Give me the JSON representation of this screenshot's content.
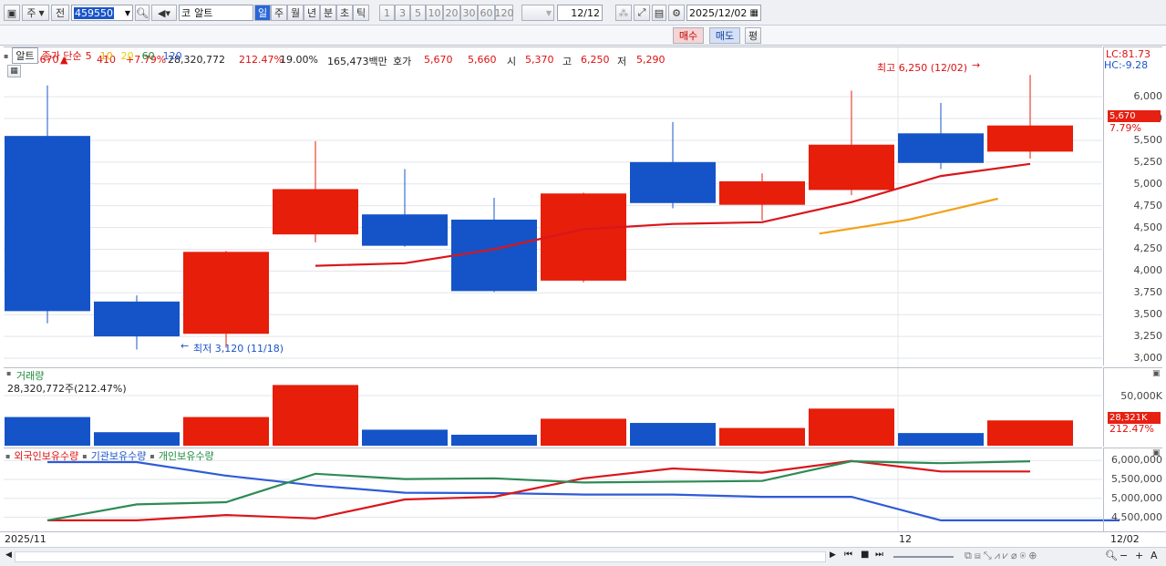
{
  "toolbar": {
    "market": "주",
    "prev_label": "전",
    "code": "459550",
    "stock_name": "알트",
    "periods": [
      "일",
      "주",
      "월",
      "년",
      "분",
      "초",
      "틱"
    ],
    "numbers": [
      "1",
      "3",
      "5",
      "10",
      "20",
      "30",
      "60",
      "120"
    ],
    "count": "12",
    "count_total": "/12",
    "date": "2025/12/02",
    "search_prefix": "코"
  },
  "quote": {
    "price": "5,670",
    "arrow": "▲",
    "change": "410",
    "change_pct": "+7.79%",
    "volume": "28,320,772",
    "volume_ratio": "212.47%",
    "turnover": "19.00%",
    "amount": "165,473백만",
    "ask_label": "호가",
    "ask": "5,670",
    "bid": "5,660",
    "open_label": "시",
    "open": "5,370",
    "high_label": "고",
    "high": "6,250",
    "low_label": "저",
    "low": "5,290",
    "buy_label": "매수",
    "sell_label": "매도",
    "eval_label": "평"
  },
  "price_panel": {
    "name": "알트",
    "ma_title": "종가 단순",
    "ma_periods": [
      {
        "label": "5",
        "color": "#d11"
      },
      {
        "label": "10",
        "color": "#f0a800"
      },
      {
        "label": "20",
        "color": "#e8d000"
      },
      {
        "label": "60",
        "color": "#1d8a3a"
      },
      {
        "label": "120",
        "color": "#2a5bd7"
      }
    ],
    "lc": "LC:81.73",
    "hc": "HC:-9.28",
    "high_note": "최고 6,250 (12/02)",
    "low_note": "최저 3,120 (11/18)",
    "cur_tag": "5,670",
    "cur_pct": "7.79%",
    "yticks": [
      "6,000",
      "5,750",
      "5,500",
      "5,250",
      "5,000",
      "4,750",
      "4,500",
      "4,250",
      "4,000",
      "3,750",
      "3,500",
      "3,250",
      "3,000"
    ]
  },
  "vol_panel": {
    "title": "거래량",
    "value": "28,320,772주(212.47%)",
    "ytick": "50,000K",
    "cur_tag": "28,321K",
    "cur_pct": "212.47%"
  },
  "hold_panel": {
    "foreign": "외국인보유수량",
    "inst": "기관보유수량",
    "indiv": "개인보유수량",
    "yticks": [
      "6,000,000",
      "5,500,000",
      "5,000,000",
      "4,500,000"
    ]
  },
  "xaxis": {
    "left": "2025/11",
    "mid": "12",
    "right": "12/02"
  },
  "chart_data": {
    "type": "candlestick",
    "ylim": [
      3000,
      6200
    ],
    "candles": [
      {
        "o": 5550,
        "h": 6130,
        "l": 3400,
        "c": 3540,
        "vol": 34
      },
      {
        "o": 3650,
        "h": 3720,
        "l": 3100,
        "c": 3250,
        "vol": 16
      },
      {
        "o": 3280,
        "h": 4230,
        "l": 3120,
        "c": 4220,
        "vol": 34
      },
      {
        "o": 4420,
        "h": 5490,
        "l": 4330,
        "c": 4940,
        "vol": 72
      },
      {
        "o": 4650,
        "h": 5170,
        "l": 4280,
        "c": 4290,
        "vol": 19
      },
      {
        "o": 4590,
        "h": 4840,
        "l": 3760,
        "c": 3770,
        "vol": 13
      },
      {
        "o": 3890,
        "h": 4900,
        "l": 3870,
        "c": 4890,
        "vol": 32
      },
      {
        "o": 5250,
        "h": 5710,
        "l": 4720,
        "c": 4780,
        "vol": 27
      },
      {
        "o": 4760,
        "h": 5120,
        "l": 4580,
        "c": 5030,
        "vol": 21
      },
      {
        "o": 4930,
        "h": 6070,
        "l": 4870,
        "c": 5450,
        "vol": 44
      },
      {
        "o": 5580,
        "h": 5930,
        "l": 5170,
        "c": 5240,
        "vol": 15
      },
      {
        "o": 5370,
        "h": 6250,
        "l": 5290,
        "c": 5670,
        "vol": 30
      }
    ],
    "ma5": [
      null,
      null,
      null,
      null,
      4060,
      4090,
      4250,
      4480,
      4540,
      4560,
      4790,
      5090,
      5230
    ],
    "ma10": [
      null,
      null,
      null,
      null,
      null,
      null,
      null,
      null,
      null,
      4430,
      4590,
      4830
    ],
    "foreign_hold": [
      null,
      4420000,
      4420000,
      4560000,
      4470000,
      4970000,
      5040000,
      5530000,
      5790000,
      5680000,
      5990000,
      5710000,
      5710000
    ],
    "inst_hold": [
      5960000,
      5960000,
      5600000,
      5340000,
      5150000,
      5140000,
      5100000,
      5100000,
      5040000,
      5040000,
      4420000,
      4420000,
      4420000
    ],
    "indiv_hold": [
      null,
      4420000,
      4840000,
      4900000,
      5650000,
      5510000,
      5530000,
      5420000,
      5440000,
      5460000,
      5980000,
      5930000,
      5980000
    ],
    "vol_max": 80
  }
}
